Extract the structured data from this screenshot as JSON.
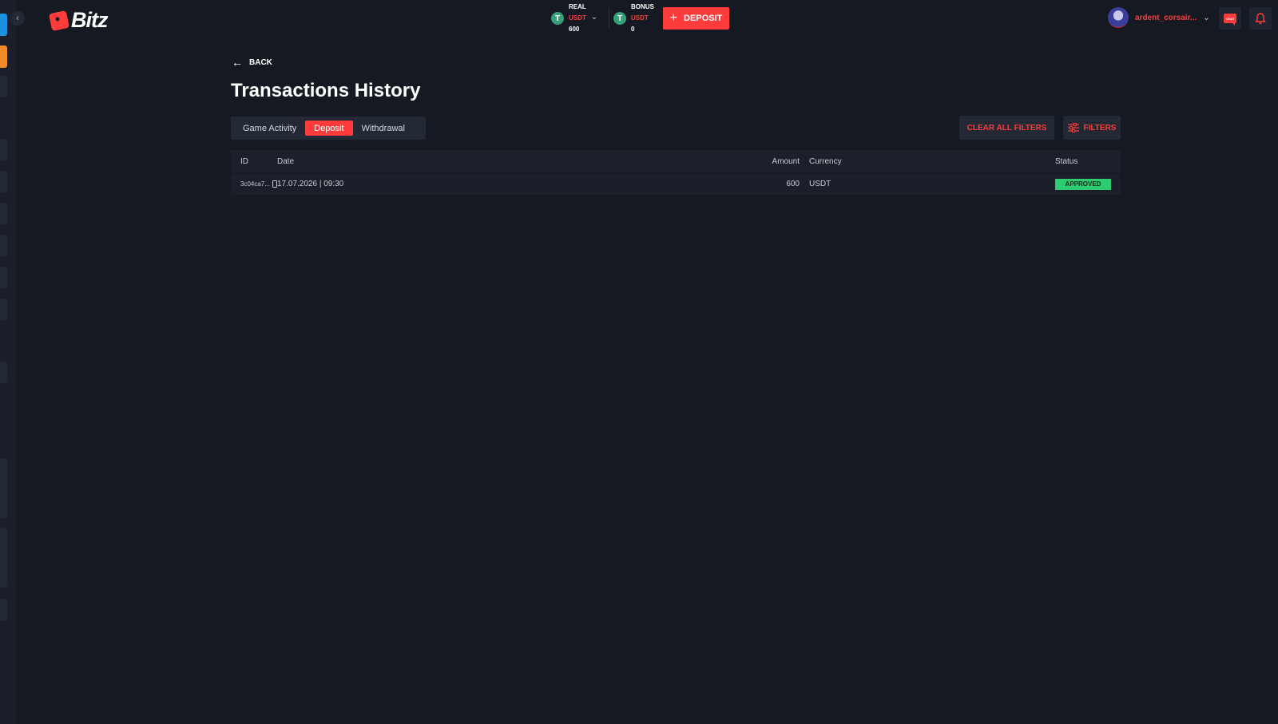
{
  "header": {
    "logo_text": "Bitz",
    "wallets": [
      {
        "label": "REAL",
        "currency": "USDT",
        "amount": "600",
        "coin_icon": "T"
      },
      {
        "label": "BONUS",
        "currency": "USDT",
        "amount": "0",
        "coin_icon": "T"
      }
    ],
    "deposit_label": "DEPOSIT",
    "username": "ardent_corsair...",
    "chat_label": "CHAT"
  },
  "page": {
    "back_label": "BACK",
    "title": "Transactions History",
    "tabs": [
      {
        "label": "Game Activity",
        "active": false
      },
      {
        "label": "Deposit",
        "active": true
      },
      {
        "label": "Withdrawal",
        "active": false
      }
    ],
    "clear_filters_label": "CLEAR ALL FILTERS",
    "filters_label": "FILTERS"
  },
  "table": {
    "columns": [
      "ID",
      "Date",
      "Amount",
      "Currency",
      "Status"
    ],
    "rows": [
      {
        "id": "3c04ca7...",
        "date": "17.07.2026 | 09:30",
        "amount": "600",
        "currency": "USDT",
        "status": "APPROVED"
      }
    ]
  },
  "colors": {
    "accent": "#ff3b3b",
    "background": "#151922",
    "status_approved": "#2ecc71"
  }
}
